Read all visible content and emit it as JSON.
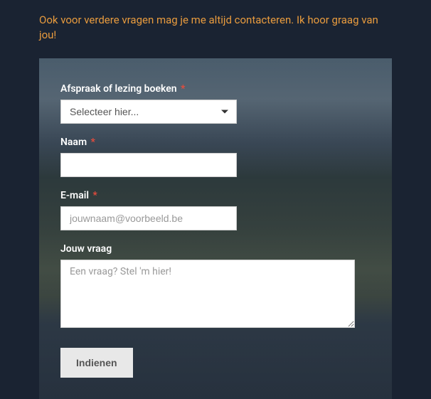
{
  "intro_text": "Ook voor verdere vragen mag je me altijd contacteren. Ik hoor graag van jou!",
  "form": {
    "booking": {
      "label": "Afspraak of lezing boeken",
      "required": "*",
      "placeholder": "Selecteer hier..."
    },
    "name": {
      "label": "Naam",
      "required": "*"
    },
    "email": {
      "label": "E-mail",
      "required": "*",
      "placeholder": "jouwnaam@voorbeeld.be"
    },
    "question": {
      "label": "Jouw vraag",
      "placeholder": "Een vraag? Stel 'm hier!"
    },
    "submit_label": "Indienen"
  }
}
